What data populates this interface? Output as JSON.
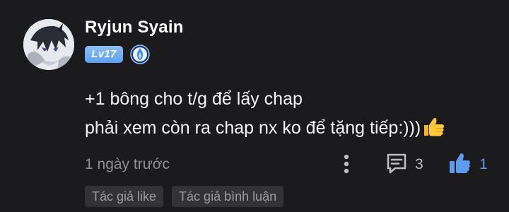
{
  "user": {
    "name": "Ryjun Syain",
    "level_badge": "Lv17",
    "avatar_icon": "anime-avatar",
    "rank_icon": "blue-flame-badge-icon"
  },
  "comment": {
    "lines": [
      "+1 bông cho t/g để lấy chap",
      "phải xem còn ra chap nx ko để tặng tiếp:)))"
    ],
    "emoji": "thumbs-up",
    "timestamp": "1 ngày trước"
  },
  "actions": {
    "more_icon": "vertical-dots-icon",
    "reply_icon": "comment-icon",
    "reply_count": "3",
    "like_icon": "thumbs-up-icon",
    "like_count": "1",
    "like_color": "#5c9bf0"
  },
  "tags": [
    "Tác giả like",
    "Tác giả bình luận"
  ],
  "colors": {
    "background": "#1b1b1d",
    "badge": "#6fa8f2",
    "muted_text": "#8f8f93",
    "tag_bg": "#333336"
  }
}
